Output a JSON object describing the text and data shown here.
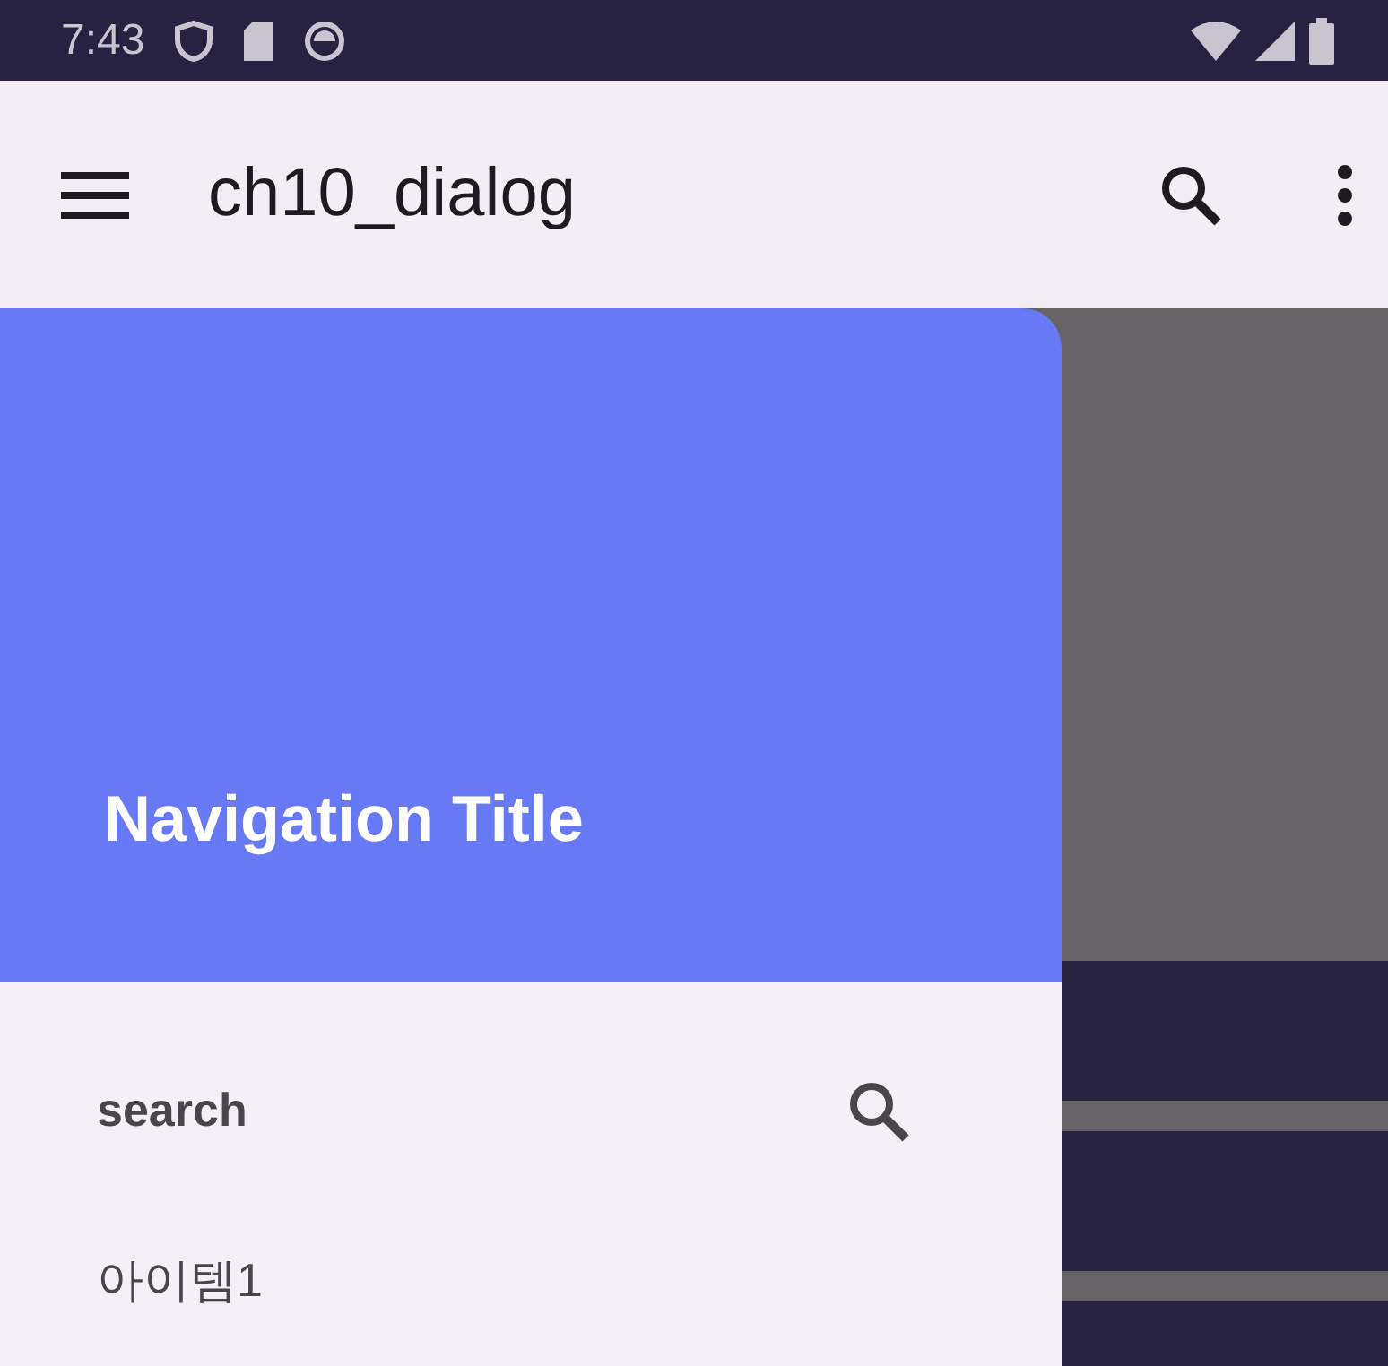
{
  "status_bar": {
    "time": "7:43"
  },
  "app_bar": {
    "title": "ch10_dialog"
  },
  "drawer": {
    "header_title": "Navigation Title",
    "items": [
      {
        "label": "search",
        "kind": "search"
      },
      {
        "label": "아이템1",
        "kind": "plain"
      }
    ]
  }
}
